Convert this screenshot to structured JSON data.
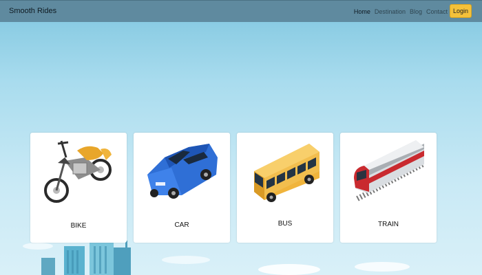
{
  "brand": "Smooth Rides",
  "nav": [
    "Home",
    "Destination",
    "Blog",
    "Contact"
  ],
  "login_label": "Login",
  "cards": [
    {
      "label": "BIKE",
      "icon": "motorcycle-icon"
    },
    {
      "label": "CAR",
      "icon": "car-icon"
    },
    {
      "label": "BUS",
      "icon": "bus-icon"
    },
    {
      "label": "TRAIN",
      "icon": "train-icon"
    }
  ],
  "colors": {
    "nav_bg": "#5f8a9f",
    "login_bg": "#f4c13a",
    "car": "#2f6fd6",
    "bus": "#f0b43c",
    "train": "#c92a2f"
  }
}
